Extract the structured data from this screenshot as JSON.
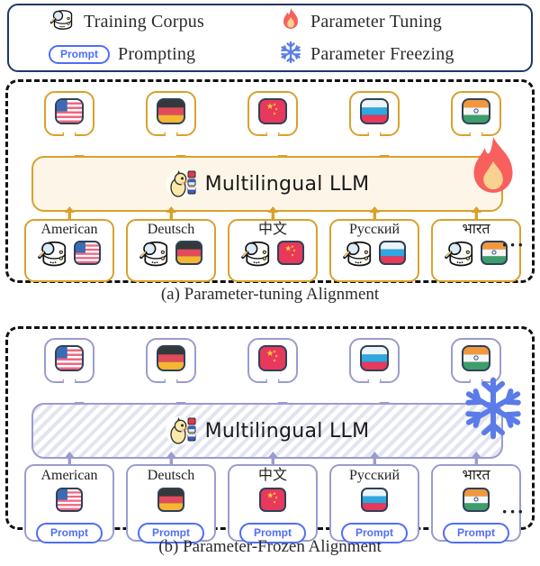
{
  "legend": {
    "items": [
      {
        "icon": "database-corpus-icon",
        "label": "Training Corpus"
      },
      {
        "icon": "prompt-pill-icon",
        "label": "Prompting",
        "pill_text": "Prompt"
      },
      {
        "icon": "fire-icon",
        "label": "Parameter Tuning"
      },
      {
        "icon": "snowflake-icon",
        "label": "Parameter Freezing"
      }
    ]
  },
  "sections": [
    {
      "id": "a",
      "caption": "(a) Parameter-tuning Alignment",
      "theme_color": "#D9A12C",
      "fill_color": "#FDF6E8",
      "model_label": "Multilingual LLM",
      "state_icon": "fire-icon",
      "ellipsis": "···",
      "languages": [
        {
          "label": "American",
          "flag": "flag-us-icon",
          "has_corpus": true,
          "prompt": null
        },
        {
          "label": "Deutsch",
          "flag": "flag-de-icon",
          "has_corpus": true,
          "prompt": null
        },
        {
          "label": "中文",
          "flag": "flag-cn-icon",
          "has_corpus": true,
          "prompt": null
        },
        {
          "label": "Русский",
          "flag": "flag-ru-icon",
          "has_corpus": true,
          "prompt": null
        },
        {
          "label": "भारत",
          "flag": "flag-in-icon",
          "has_corpus": true,
          "prompt": null
        }
      ]
    },
    {
      "id": "b",
      "caption": "(b) Parameter-Frozen Alignment",
      "theme_color": "#9A9CD0",
      "fill_color": "#FFFFFF",
      "model_label": "Multilingual LLM",
      "state_icon": "snowflake-icon",
      "ellipsis": "···",
      "languages": [
        {
          "label": "American",
          "flag": "flag-us-icon",
          "has_corpus": false,
          "prompt": "Prompt"
        },
        {
          "label": "Deutsch",
          "flag": "flag-de-icon",
          "has_corpus": false,
          "prompt": "Prompt"
        },
        {
          "label": "中文",
          "flag": "flag-cn-icon",
          "has_corpus": false,
          "prompt": "Prompt"
        },
        {
          "label": "Русский",
          "flag": "flag-ru-icon",
          "has_corpus": false,
          "prompt": "Prompt"
        },
        {
          "label": "भारत",
          "flag": "flag-in-icon",
          "has_corpus": false,
          "prompt": "Prompt"
        }
      ]
    }
  ],
  "colors": {
    "legend_border": "#1F3864",
    "prompt_blue": "#4F6EF7",
    "fire_outer": "#F8605D",
    "fire_inner": "#F9D191",
    "snow_blue": "#5B7CE8",
    "gold": "#D9A12C",
    "periwinkle": "#9A9CD0",
    "cream": "#FDF6E8"
  }
}
